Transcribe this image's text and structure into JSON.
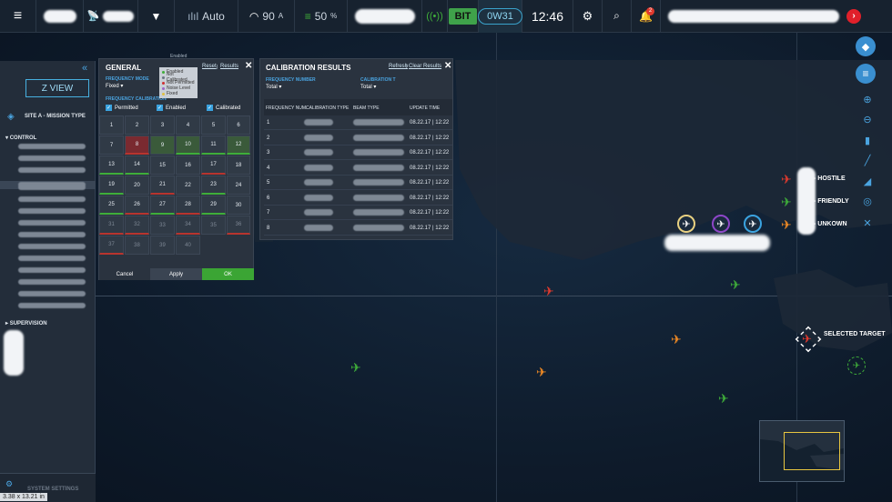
{
  "topbar": {
    "blank1": "",
    "signal": "90",
    "signal_unit": "A",
    "mode": "Auto",
    "battery": "50",
    "battery_unit": "%",
    "bit": "BIT",
    "ow": "0W31",
    "clock": "12:46",
    "notif_count": "2"
  },
  "sidebar": {
    "zview": "Z VIEW",
    "site": "SITE A - MISSION TYPE",
    "control": "CONTROL",
    "supervision": "SUPERVISION",
    "system_settings": "SYSTEM SETTINGS",
    "collapse": "«",
    "dims": "3.38 x 13.21 in"
  },
  "general": {
    "title": "GENERAL",
    "reset": "Reset",
    "sep": "|",
    "results": "Results",
    "close": "✕",
    "enabled_top": "Enabled",
    "freq_mode_label": "FREQUENCY MODE",
    "freq_mode_value": "Fixed",
    "freq_cal_label": "FREQUENCY CALIBRATION",
    "legend": [
      "Enabled",
      "Not Calibrated",
      "Not Permitted",
      "Noise Level",
      "Fixed"
    ],
    "checks": [
      "Permitted",
      "Enabled",
      "Calibrated"
    ],
    "cells": [
      "1",
      "2",
      "3",
      "4",
      "5",
      "6",
      "7",
      "8",
      "9",
      "10",
      "11",
      "12",
      "13",
      "14",
      "15",
      "16",
      "17",
      "18",
      "19",
      "20",
      "21",
      "22",
      "23",
      "24",
      "25",
      "26",
      "27",
      "28",
      "29",
      "30",
      "31",
      "32",
      "33",
      "34",
      "35",
      "36",
      "37",
      "38",
      "39",
      "40"
    ],
    "cancel": "Cancel",
    "apply": "Apply",
    "ok": "OK"
  },
  "calibration": {
    "title": "CALIBRATION RESULTS",
    "refresh": "Refresh",
    "sep": "|",
    "clear": "Clear Results",
    "close": "✕",
    "freq_number_label": "FREQUENCY NUMBER",
    "freq_number_value": "Total",
    "cal_t_label": "CALIBRATION T",
    "cal_t_value": "Total",
    "headers": [
      "FREQUENCY NUM.",
      "CALIBRATION TYPE",
      "BEAM TYPE",
      "UPDATE TIME"
    ],
    "rows": [
      {
        "num": "1",
        "time": "08.22.17 | 12:22"
      },
      {
        "num": "2",
        "time": "08.22.17 | 12:22"
      },
      {
        "num": "3",
        "time": "08.22.17 | 12:22"
      },
      {
        "num": "4",
        "time": "08.22.17 | 12:22"
      },
      {
        "num": "5",
        "time": "08.22.17 | 12:22"
      },
      {
        "num": "6",
        "time": "08.22.17 | 12:22"
      },
      {
        "num": "7",
        "time": "08.22.17 | 12:22"
      },
      {
        "num": "8",
        "time": "08.22.17 | 12:22"
      }
    ]
  },
  "legend": {
    "hostile": "- HOSTILE",
    "friendly": "- FRIENDLY",
    "unknown": "- UNKOWN"
  },
  "selected_target": "SELECTED TARGET",
  "colors": {
    "hostile": "#e03a2e",
    "friendly": "#3fae3a",
    "unknown": "#f08a24",
    "accent": "#3aa3e0"
  }
}
